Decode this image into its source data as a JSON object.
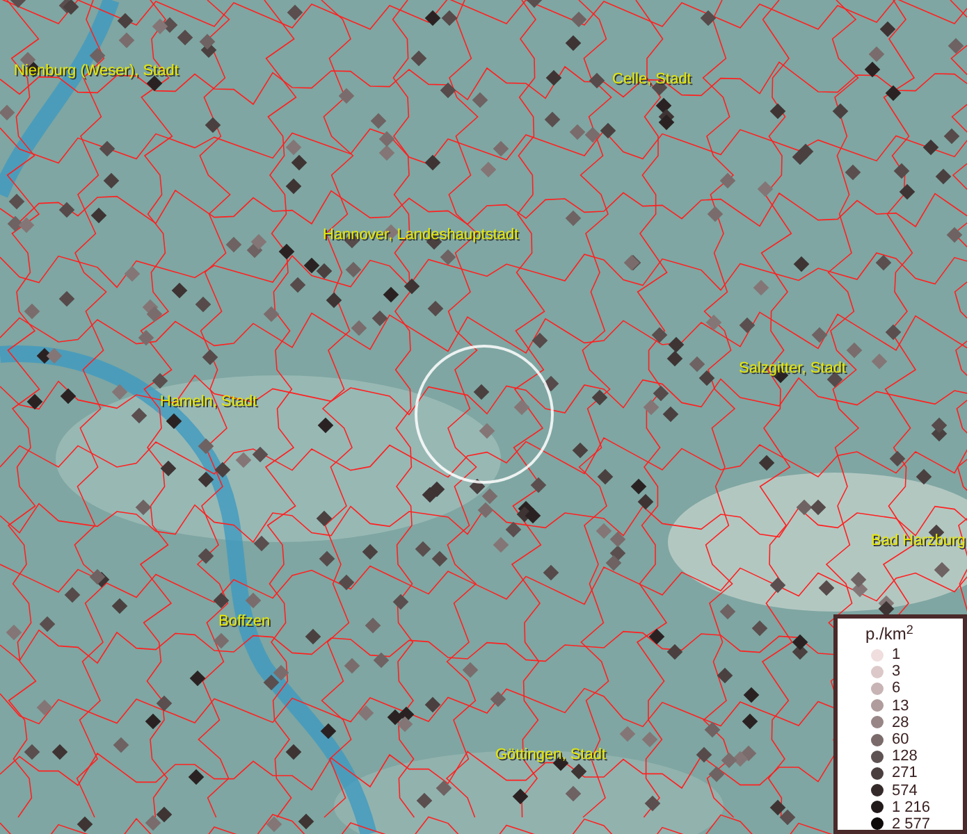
{
  "map": {
    "places": [
      {
        "label": "Nienburg (Weser), Stadt"
      },
      {
        "label": "Celle, Stadt"
      },
      {
        "label": "Hannover, Landeshauptstadt"
      },
      {
        "label": "Salzgitter, Stadt"
      },
      {
        "label": "Hameln, Stadt"
      },
      {
        "label": "Bad Harzburg"
      },
      {
        "label": "Boffzen"
      },
      {
        "label": "Göttingen, Stadt"
      }
    ]
  },
  "legend": {
    "title": "p./km$^{2}$",
    "items": [
      {
        "label": "1",
        "color": "#f0dede"
      },
      {
        "label": "3",
        "color": "#dcc8c8"
      },
      {
        "label": "6",
        "color": "#c8b4b4"
      },
      {
        "label": "13",
        "color": "#b09c9c"
      },
      {
        "label": "28",
        "color": "#988686"
      },
      {
        "label": "60",
        "color": "#7a6a6a"
      },
      {
        "label": "128",
        "color": "#5e5252"
      },
      {
        "label": "271",
        "color": "#4a3e3e"
      },
      {
        "label": "574",
        "color": "#342a2a"
      },
      {
        "label": "1 216",
        "color": "#221a1a"
      },
      {
        "label": "2 577",
        "color": "#0e0a0a"
      }
    ]
  }
}
